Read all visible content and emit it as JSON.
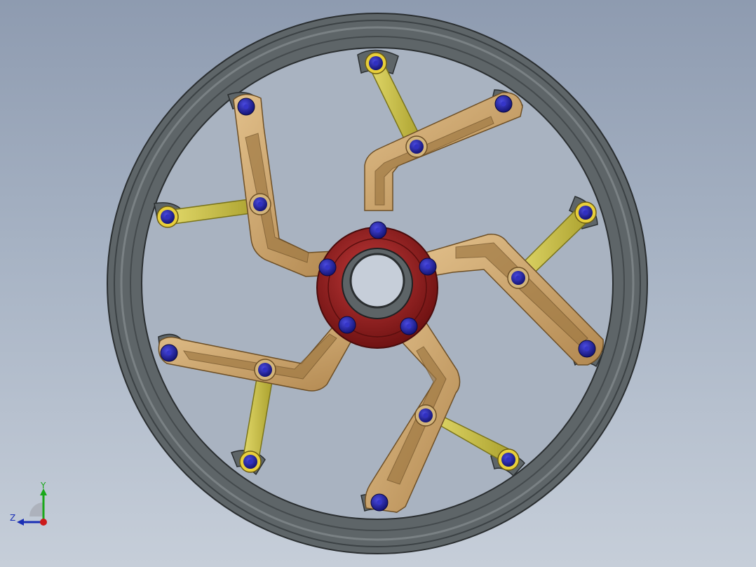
{
  "window": {
    "background_top": "#8e9bb0",
    "background_bottom": "#c6ced9"
  },
  "model": {
    "rim_color": "#5c6366",
    "rim_dark": "#3a3f42",
    "hub_color": "#8e1f1f",
    "hub_bore_color": "#2f3436",
    "arm_color": "#c8a06a",
    "arm_dark": "#8a6a3e",
    "link_color": "#c9c050",
    "link_dark": "#807a1e",
    "bolt_color": "#1f1f9e",
    "bolt_ring": "#e8cf3a"
  },
  "triad": {
    "y_label": "Y",
    "z_label": "Z",
    "y_color": "#1aa81a",
    "z_color": "#1a2fb5",
    "origin_color": "#cc1a1a"
  }
}
